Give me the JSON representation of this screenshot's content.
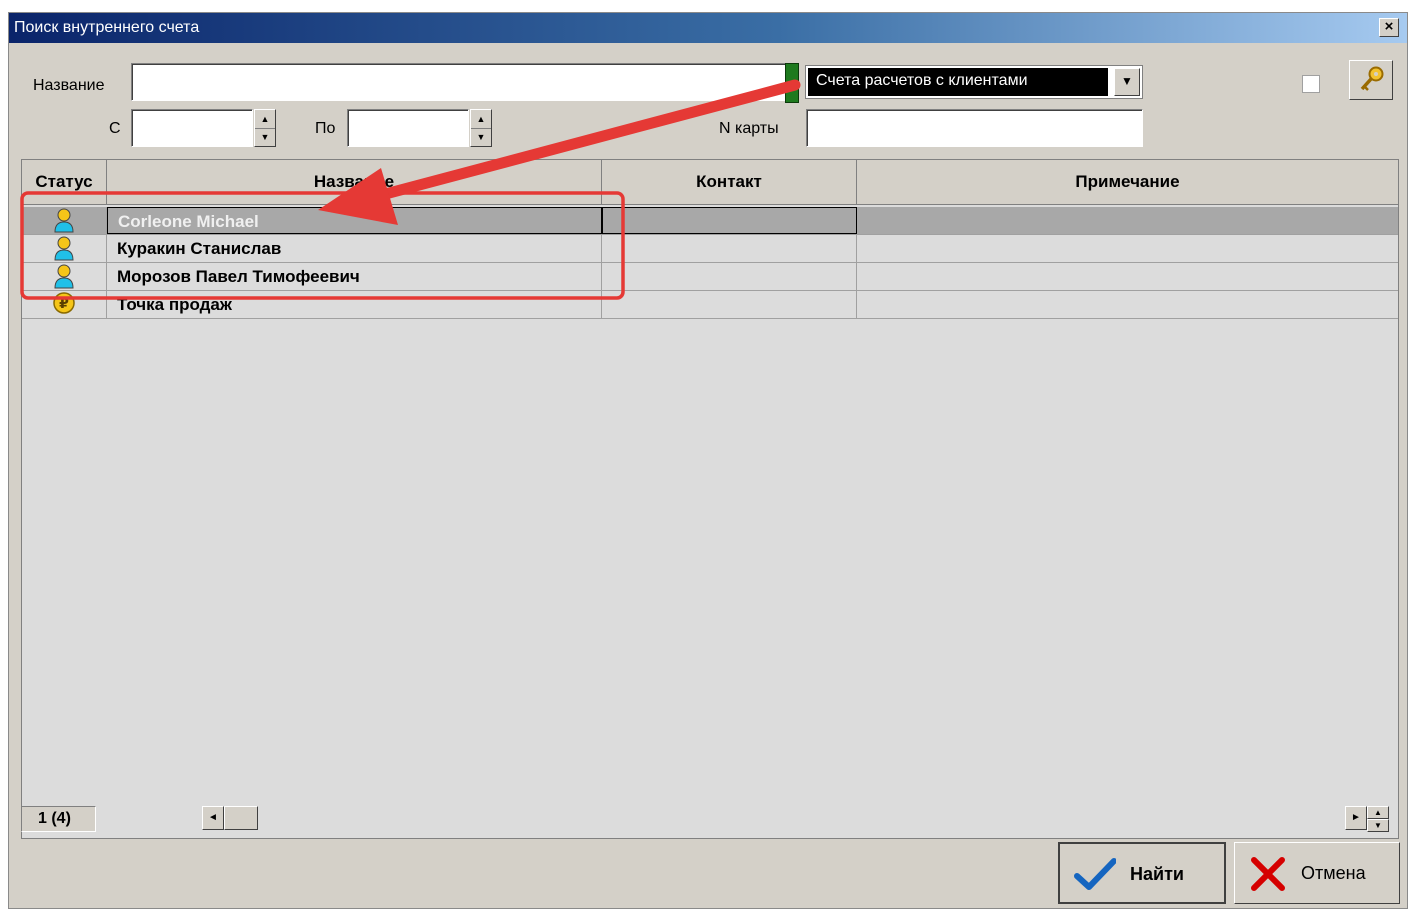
{
  "window": {
    "title": "Поиск внутреннего счета",
    "close_label": "×"
  },
  "filters": {
    "name_label": "Название",
    "name_value": "",
    "from_label": "С",
    "from_value": "",
    "to_label": "По",
    "to_value": "",
    "card_label": "N карты",
    "card_value": "",
    "account_type": "Счета расчетов с клиентами"
  },
  "grid": {
    "columns": [
      "Статус",
      "Название",
      "Контакт",
      "Примечание"
    ],
    "rows": [
      {
        "status_icon": "person-icon",
        "name": "Corleone Michael",
        "contact": "",
        "note": "",
        "selected": true
      },
      {
        "status_icon": "person-icon",
        "name": "Куракин Станислав",
        "contact": "",
        "note": "",
        "selected": false
      },
      {
        "status_icon": "person-icon",
        "name": "Морозов Павел Тимофеевич",
        "contact": "",
        "note": "",
        "selected": false
      },
      {
        "status_icon": "ruble-coin-icon",
        "name": "Точка продаж",
        "contact": "",
        "note": "",
        "selected": false
      }
    ],
    "page_info": "1 (4)"
  },
  "buttons": {
    "find": "Найти",
    "cancel": "Отмена"
  },
  "colors": {
    "annotation": "#e53935",
    "title_start": "#0a246a",
    "title_end": "#a6caf0",
    "find_check": "#1565c0",
    "cancel_x": "#d50000"
  }
}
